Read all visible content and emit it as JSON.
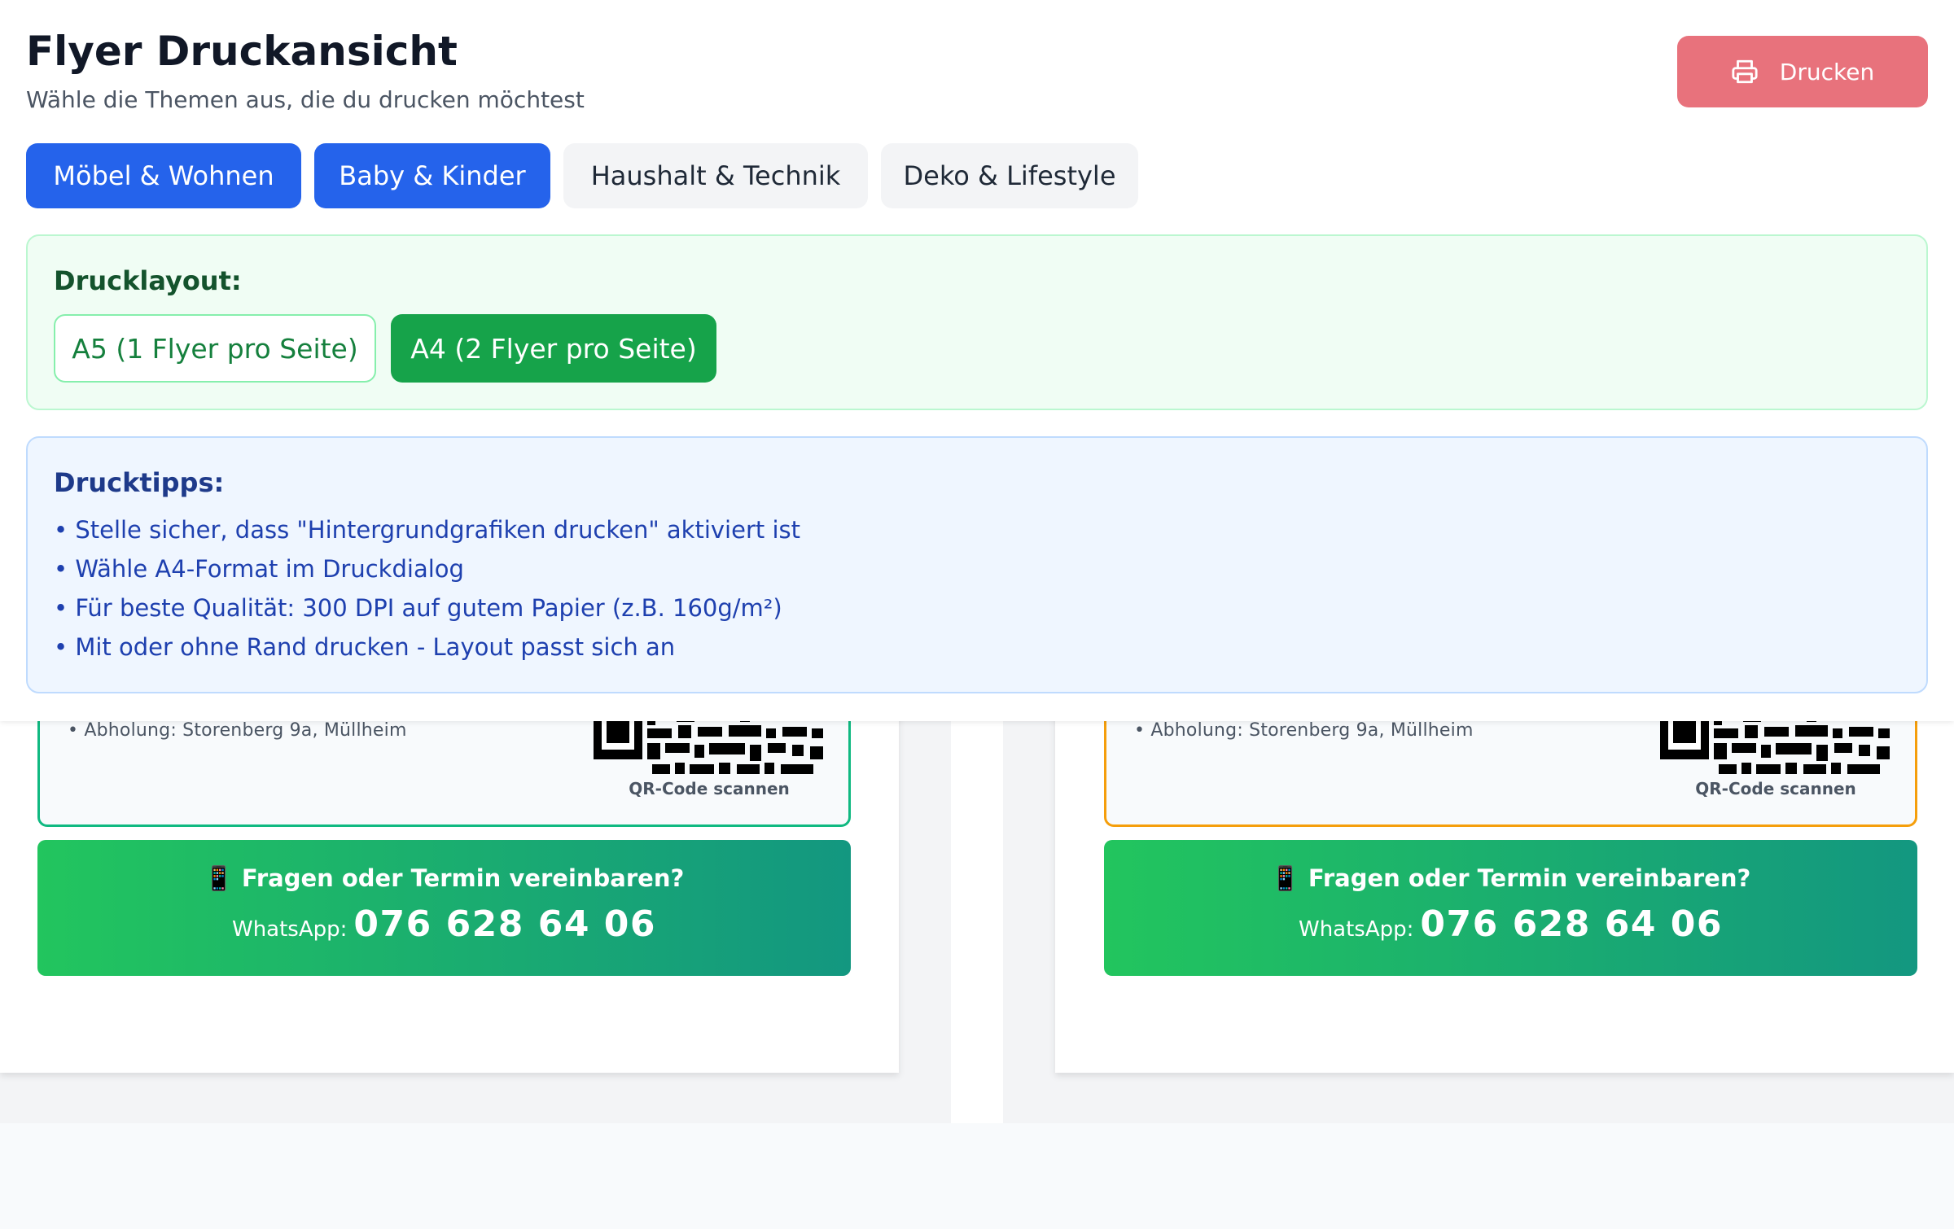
{
  "header": {
    "title": "Flyer Druckansicht",
    "subtitle": "Wähle die Themen aus, die du drucken möchtest",
    "print_label": "Drucken"
  },
  "topics": [
    {
      "label": "Möbel & Wohnen",
      "active": true
    },
    {
      "label": "Baby & Kinder",
      "active": true
    },
    {
      "label": "Haushalt & Technik",
      "active": false
    },
    {
      "label": "Deko & Lifestyle",
      "active": false
    }
  ],
  "layout": {
    "heading": "Drucklayout:",
    "options": [
      {
        "label": "A5 (1 Flyer pro Seite)",
        "selected": false
      },
      {
        "label": "A4 (2 Flyer pro Seite)",
        "selected": true
      }
    ]
  },
  "tips": {
    "heading": "Drucktipps:",
    "items": [
      "• Stelle sicher, dass \"Hintergrundgrafiken drucken\" aktiviert ist",
      "• Wähle A4-Format im Druckdialog",
      "• Für beste Qualität: 300 DPI auf gutem Papier (z.B. 160g/m²)",
      "• Mit oder ohne Rand drucken - Layout passt sich an"
    ]
  },
  "flyers": [
    {
      "pickup": "• Abholung: Storenberg 9a, Müllheim",
      "qr_label": "QR-Code scannen",
      "contact_question": "📱 Fragen oder Termin vereinbaren?",
      "whatsapp_label": "WhatsApp:",
      "whatsapp_number": "076 628 64 06",
      "border_color": "#10b981"
    },
    {
      "pickup": "• Abholung: Storenberg 9a, Müllheim",
      "qr_label": "QR-Code scannen",
      "contact_question": "📱 Fragen oder Termin vereinbaren?",
      "whatsapp_label": "WhatsApp:",
      "whatsapp_number": "076 628 64 06",
      "border_color": "#f59e0b"
    }
  ],
  "colors": {
    "accent_blue": "#2563eb",
    "print_button": "#e8727c",
    "layout_green": "#16a34a",
    "whatsapp_green": "#22c55e"
  },
  "icons": {
    "print": "printer-icon",
    "qr": "qr-code-icon"
  }
}
